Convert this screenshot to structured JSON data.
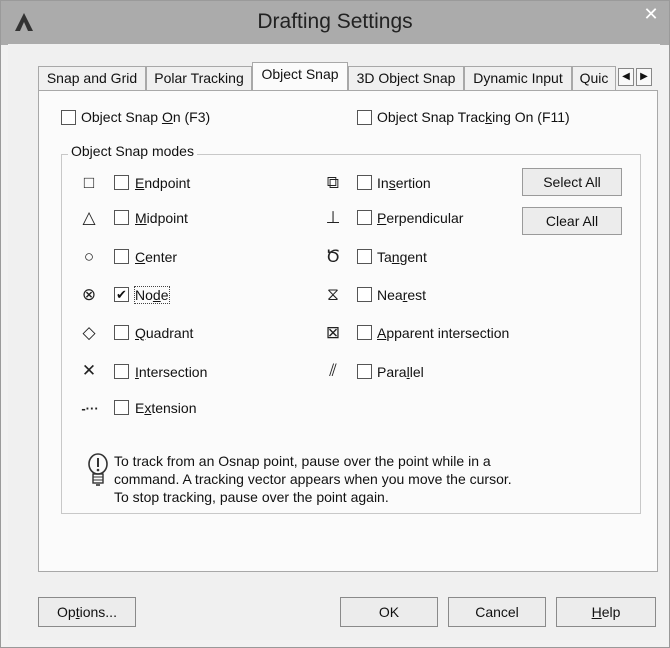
{
  "window": {
    "title": "Drafting Settings",
    "close_glyph": "✕"
  },
  "tabs": [
    {
      "label": "Snap and Grid"
    },
    {
      "label": "Polar Tracking"
    },
    {
      "label": "Object Snap"
    },
    {
      "label": "3D Object Snap"
    },
    {
      "label": "Dynamic Input"
    },
    {
      "label": "Quic"
    }
  ],
  "tab_scroll": {
    "left": "◀",
    "right": "▶"
  },
  "header": {
    "osnap_on": {
      "pre": "Object Snap ",
      "ul": "O",
      "post": "n (F3)",
      "checked": false
    },
    "tracking_on": {
      "pre": "Object Snap Trac",
      "ul": "k",
      "post": "ing On (F11)",
      "checked": false
    }
  },
  "group_title": "Object Snap modes",
  "modes_left": [
    {
      "pre": "",
      "ul": "E",
      "post": "ndpoint",
      "icon": "square-icon",
      "glyph": "□",
      "checked": false
    },
    {
      "pre": "",
      "ul": "M",
      "post": "idpoint",
      "icon": "triangle-icon",
      "glyph": "△",
      "checked": false
    },
    {
      "pre": "",
      "ul": "C",
      "post": "enter",
      "icon": "circle-icon",
      "glyph": "○",
      "checked": false
    },
    {
      "pre": "No",
      "ul": "d",
      "post": "e",
      "icon": "node-icon",
      "glyph": "⊗",
      "checked": true
    },
    {
      "pre": "",
      "ul": "Q",
      "post": "uadrant",
      "icon": "diamond-icon",
      "glyph": "◇",
      "checked": false
    },
    {
      "pre": "",
      "ul": "I",
      "post": "ntersection",
      "icon": "cross-icon",
      "glyph": "✕",
      "checked": false
    },
    {
      "pre": "E",
      "ul": "x",
      "post": "tension",
      "icon": "extension-icon",
      "glyph": "-···",
      "checked": false
    }
  ],
  "modes_right": [
    {
      "pre": "In",
      "ul": "s",
      "post": "ertion",
      "icon": "insertion-icon",
      "glyph": "⧉",
      "checked": false
    },
    {
      "pre": "",
      "ul": "P",
      "post": "erpendicular",
      "icon": "perpendicular-icon",
      "glyph": "⊥",
      "checked": false
    },
    {
      "pre": "Ta",
      "ul": "n",
      "post": "gent",
      "icon": "tangent-icon",
      "glyph": "Ծ",
      "checked": false
    },
    {
      "pre": "Nea",
      "ul": "r",
      "post": "est",
      "icon": "nearest-icon",
      "glyph": "⧖",
      "checked": false
    },
    {
      "pre": "",
      "ul": "A",
      "post": "pparent intersection",
      "icon": "apparent-intersection-icon",
      "glyph": "⊠",
      "checked": false
    },
    {
      "pre": "Para",
      "ul": "l",
      "post": "lel",
      "icon": "parallel-icon",
      "glyph": "⫽",
      "checked": false
    }
  ],
  "buttons": {
    "select_all": "Select All",
    "clear_all": "Clear All"
  },
  "tip": {
    "line1": "To track from an Osnap point, pause over the point while in a",
    "line2": "command.  A tracking vector appears when you move the cursor.",
    "line3": "To stop tracking, pause over the point again."
  },
  "bottom": {
    "options": {
      "pre": "Op",
      "ul": "t",
      "post": "ions..."
    },
    "ok": "OK",
    "cancel": "Cancel",
    "help": {
      "pre": "",
      "ul": "H",
      "post": "elp"
    }
  }
}
